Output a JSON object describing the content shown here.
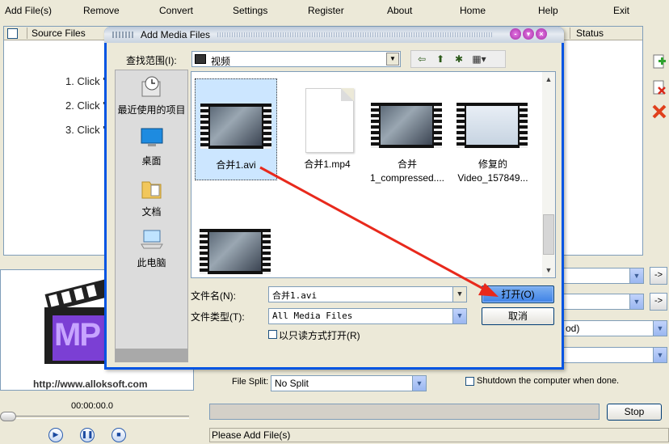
{
  "menu": [
    {
      "label": "Add File(s)"
    },
    {
      "label": "Remove"
    },
    {
      "label": "Convert"
    },
    {
      "label": "Settings"
    },
    {
      "label": "Register"
    },
    {
      "label": "About"
    },
    {
      "label": "Home"
    },
    {
      "label": "Help"
    },
    {
      "label": "Exit"
    }
  ],
  "file_list": {
    "col_source": "Source Files",
    "col_status": "Status",
    "steps": [
      "1. Click '",
      "2. Click '",
      "3. Click '"
    ]
  },
  "preview": {
    "logo_text": "MP",
    "url": "http://www.alloksoft.com",
    "timecode": "00:00:00.0"
  },
  "options": {
    "file_split_label": "File Split:",
    "file_split_value": "No Split",
    "shutdown_label": "Shutdown the computer when done.",
    "partial_value": "od)",
    "stop_label": "Stop",
    "status_text": "Please Add File(s)"
  },
  "dialog": {
    "title": "Add Media Files",
    "look_in_label": "查找范围(I):",
    "look_in_value": "视频",
    "places": [
      {
        "label": "最近使用的项目",
        "icon": "recent-items-icon"
      },
      {
        "label": "桌面",
        "icon": "desktop-icon"
      },
      {
        "label": "文档",
        "icon": "documents-icon"
      },
      {
        "label": "此电脑",
        "icon": "computer-icon"
      }
    ],
    "files": [
      {
        "name": "合并1.avi",
        "type": "video",
        "selected": true
      },
      {
        "name": "合并1.mp4",
        "type": "document",
        "selected": false
      },
      {
        "name": "合并\n1_compressed....",
        "type": "video",
        "selected": false
      },
      {
        "name": "修复的\nVideo_157849...",
        "type": "video-screenshot",
        "selected": false
      },
      {
        "name": "",
        "type": "video",
        "selected": false
      }
    ],
    "filename_label": "文件名(N):",
    "filename_value": "合并1.avi",
    "filetype_label": "文件类型(T):",
    "filetype_value": "All Media Files",
    "readonly_label": "以只读方式打开(R)",
    "open_label": "打开(O)",
    "cancel_label": "取消"
  },
  "colors": {
    "annotation_arrow": "#e8291c",
    "dialog_border": "#0054e3",
    "selection": "#cce6ff"
  }
}
